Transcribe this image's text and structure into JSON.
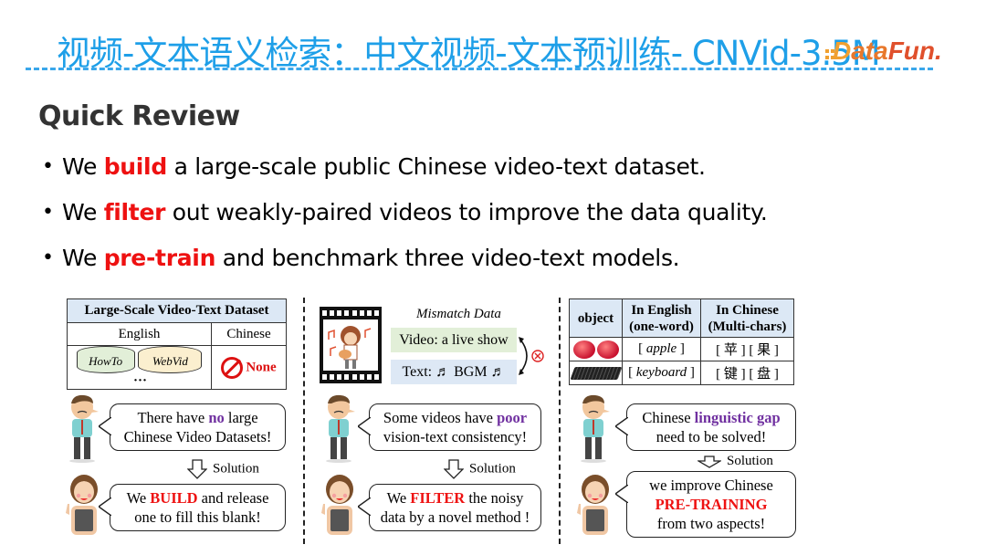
{
  "header": {
    "title": "视频-文本语义检索：中文视频-文本预训练- CNVid-3.5M",
    "logo": {
      "part1": "D",
      "part2": "ata",
      "part3": "Fun."
    }
  },
  "heading": "Quick Review",
  "bullets": [
    {
      "prefix": "We ",
      "highlight": "build",
      "suffix": " a large-scale public Chinese video-text dataset."
    },
    {
      "prefix": "We ",
      "highlight": "filter",
      "suffix": " out weakly-paired videos to improve the data quality."
    },
    {
      "prefix": "We ",
      "highlight": "pre-train",
      "suffix": " and benchmark three video-text models."
    }
  ],
  "panel1": {
    "table_title": "Large-Scale Video-Text Dataset",
    "col_english": "English",
    "col_chinese": "Chinese",
    "datasets": [
      "HowTo",
      "WebVid"
    ],
    "ellipsis": "···",
    "none_label": "None",
    "problem": {
      "pre": "There have ",
      "highlight": "no",
      "post1": " large",
      "line2": "Chinese Video Datasets!"
    },
    "solution_label": "Solution",
    "answer": {
      "pre": "We ",
      "highlight": "BUILD",
      "post1": " and release",
      "line2": "one to fill this blank!"
    }
  },
  "panel2": {
    "mismatch_label": "Mismatch Data",
    "video_box": "Video: a live show",
    "text_box": "Text: ♬ BGM ♬",
    "problem": {
      "line1_pre": "Some videos have ",
      "highlight": "poor",
      "line2": "vision-text consistency!"
    },
    "solution_label": "Solution",
    "answer": {
      "pre": "We ",
      "highlight": "FILTER",
      "post1": " the noisy",
      "line2": "data by a novel method !"
    }
  },
  "panel3": {
    "headers": [
      "object",
      "In English\n(one-word)",
      "In Chinese\n(Multi-chars)"
    ],
    "header_en_1": "In English",
    "header_en_2": "(one-word)",
    "header_zh_1": "In Chinese",
    "header_zh_2": "(Multi-chars)",
    "rows": [
      {
        "object": "apple-image",
        "english": "apple",
        "chinese": "[ 苹 ] [ 果 ]"
      },
      {
        "object": "keyboard-image",
        "english": "keyboard",
        "chinese": "[ 键 ] [ 盘 ]"
      }
    ],
    "problem": {
      "pre": "Chinese ",
      "highlight": "linguistic gap",
      "line2": "need to be solved!"
    },
    "solution_label": "Solution",
    "answer": {
      "line1": "we improve Chinese",
      "highlight": "PRE-TRAINING",
      "line3": "from two aspects!"
    }
  },
  "colors": {
    "title": "#1e9fe8",
    "highlight_red": "#ee1111",
    "highlight_purple": "#7030a0",
    "table_header_bg": "#dce8f5",
    "green_box": "#e2efd8",
    "blue_box": "#dde8f5"
  }
}
